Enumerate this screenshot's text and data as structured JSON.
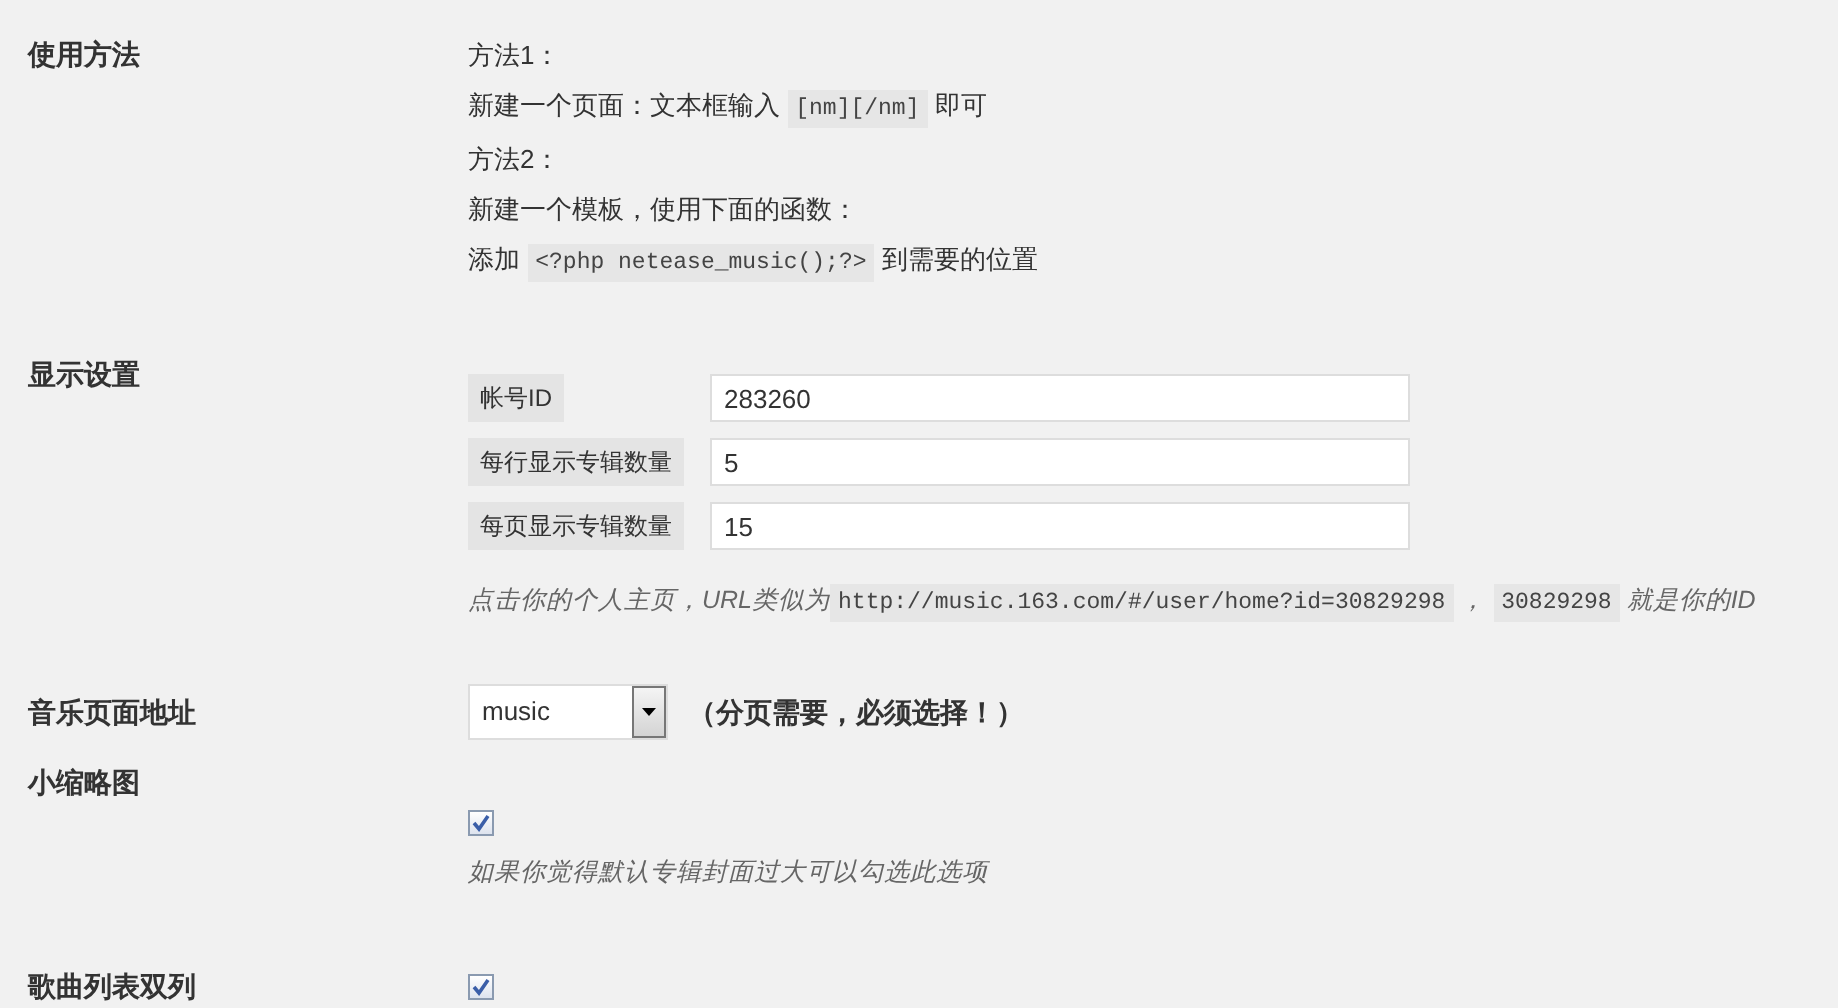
{
  "usage": {
    "label": "使用方法",
    "lines": [
      {
        "parts": [
          {
            "kind": "text",
            "text": "方法1："
          }
        ]
      },
      {
        "parts": [
          {
            "kind": "text",
            "text": "新建一个页面：文本框输入 "
          },
          {
            "kind": "code",
            "text": "[nm][/nm]"
          },
          {
            "kind": "text",
            "text": " 即可"
          }
        ]
      },
      {
        "parts": [
          {
            "kind": "text",
            "text": "方法2："
          }
        ]
      },
      {
        "parts": [
          {
            "kind": "text",
            "text": "新建一个模板，使用下面的函数："
          }
        ]
      },
      {
        "parts": [
          {
            "kind": "text",
            "text": "添加 "
          },
          {
            "kind": "code",
            "text": "<?php netease_music();?>"
          },
          {
            "kind": "text",
            "text": " 到需要的位置"
          }
        ]
      }
    ]
  },
  "display": {
    "label": "显示设置",
    "fields": [
      {
        "label": "帐号ID",
        "value": "283260"
      },
      {
        "label": "每行显示专辑数量",
        "value": "5"
      },
      {
        "label": "每页显示专辑数量",
        "value": "15"
      }
    ],
    "hint": [
      {
        "kind": "text",
        "text": "点击你的个人主页，URL类似为"
      },
      {
        "kind": "code",
        "text": "http://music.163.com/#/user/home?id=30829298"
      },
      {
        "kind": "text",
        "text": " ， "
      },
      {
        "kind": "code",
        "text": "30829298"
      },
      {
        "kind": "text",
        "text": " 就是你的ID"
      }
    ]
  },
  "music_page": {
    "label": "音乐页面地址",
    "value": "music",
    "note": "（分页需要，必须选择！）"
  },
  "thumbnail": {
    "label": "小缩略图",
    "checked": true,
    "hint": "如果你觉得默认专辑封面过大可以勾选此选项"
  },
  "double_column": {
    "label": "歌曲列表双列",
    "checked": true
  }
}
